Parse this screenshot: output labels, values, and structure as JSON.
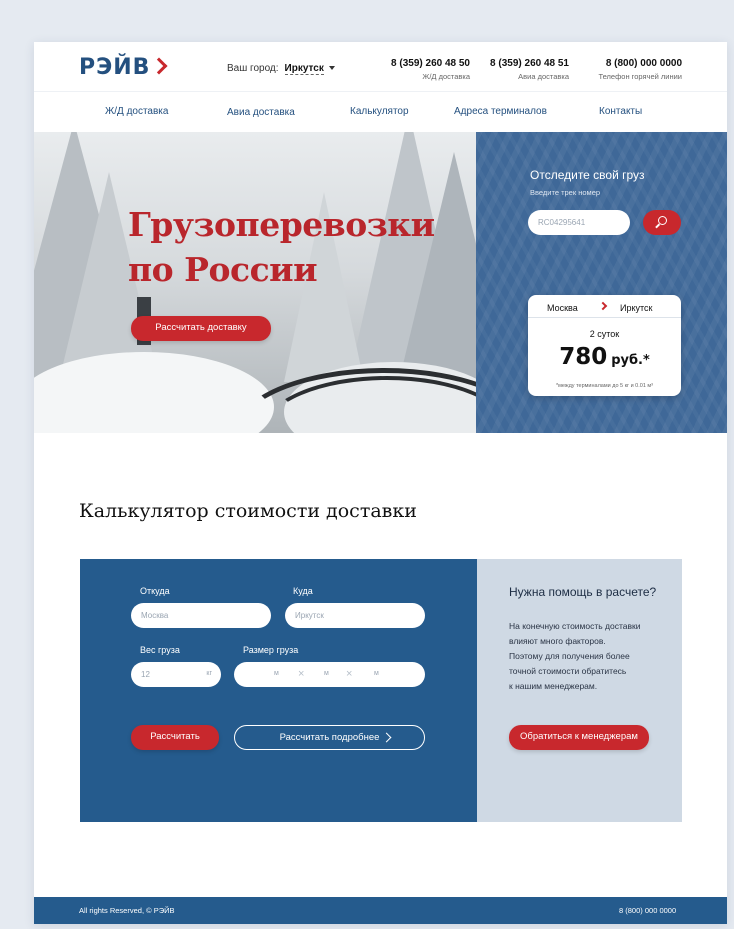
{
  "header": {
    "logo": "РЭЙВ",
    "city_label": "Ваш город:",
    "city_value": "Иркутск",
    "phones": [
      {
        "number": "8 (359) 260 48 50",
        "caption": "Ж/Д доставка"
      },
      {
        "number": "8 (359) 260 48 51",
        "caption": "Авиа доставка"
      },
      {
        "number": "8 (800) 000 0000",
        "caption": "Телефон горячей линии"
      }
    ]
  },
  "nav": [
    "Ж/Д доставка",
    "Авиа доставка",
    "Калькулятор",
    "Адреса терминалов",
    "Контакты"
  ],
  "hero": {
    "title_line1": "Грузоперевозки",
    "title_line2": "по России",
    "cta": "Рассчитать доставку"
  },
  "tracking": {
    "title": "Отследите свой груз",
    "subtitle": "Введите трек номер",
    "input_value": "RC04295641",
    "route_from": "Москва",
    "route_to": "Иркутск",
    "days": "2 суток",
    "price": "780",
    "currency": "руб.*",
    "note": "*между терминалами до 5 кг и 0.01 м³"
  },
  "calculator": {
    "title": "Калькулятор стоимости доставки",
    "from_label": "Откуда",
    "from_placeholder": "Москва",
    "to_label": "Куда",
    "to_placeholder": "Иркутск",
    "weight_label": "Вес груза",
    "weight_value": "12",
    "weight_unit": "кг",
    "size_label": "Размер груза",
    "size_unit": "м",
    "size_sep": "×",
    "calc_button": "Рассчитать",
    "detail_button": "Рассчитать подробнее"
  },
  "help": {
    "title": "Нужна помощь в расчете?",
    "lines": [
      "На конечную стоимость доставки",
      "влияют много факторов.",
      "Поэтому для получения более",
      "точной стоимости обратитесь",
      "к нашим менеджерам."
    ],
    "button": "Обратиться к менеджерам"
  },
  "footer": {
    "copyright": "All rights Reserved, © РЭЙВ",
    "phone": "8 (800) 000 0000"
  },
  "colors": {
    "brand_blue": "#255b8d",
    "accent_red": "#c8282d",
    "help_bg": "#cfd9e4"
  }
}
